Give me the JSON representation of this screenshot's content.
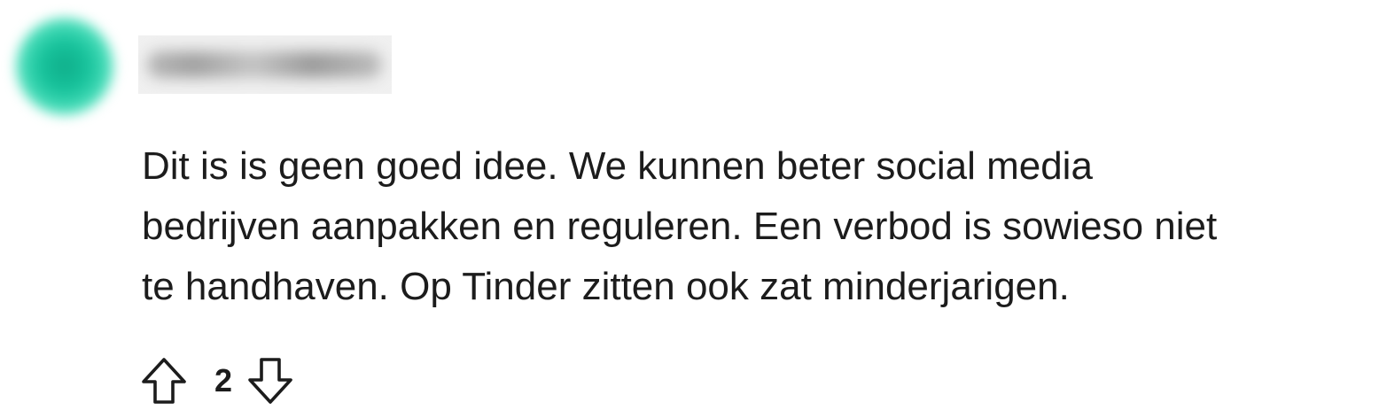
{
  "comment": {
    "avatar": {
      "icon": "avatar-icon",
      "color": "#17c39c"
    },
    "author": {
      "username": ""
    },
    "body": {
      "lines": [
        "Dit is is geen goed idee. We kunnen beter social media",
        "bedrijven aanpakken en reguleren. Een verbod is sowieso niet",
        "te handhaven. Op Tinder zitten ook zat minderjarigen."
      ]
    },
    "actions": {
      "upvote_icon": "upvote-arrow-icon",
      "downvote_icon": "downvote-arrow-icon",
      "score": "2"
    }
  }
}
